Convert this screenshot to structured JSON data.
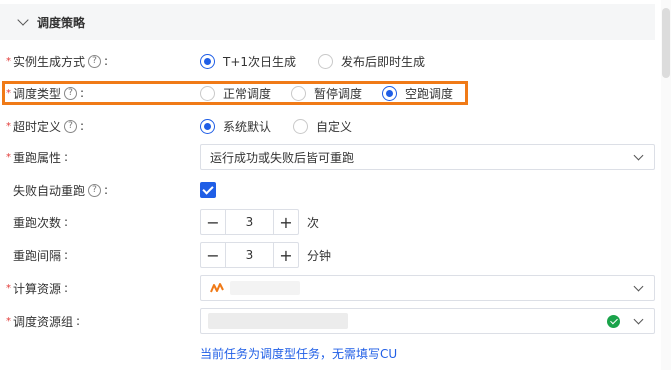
{
  "section": {
    "title": "调度策略"
  },
  "fields": {
    "instance_gen": {
      "label": "实例生成方式",
      "required": "*",
      "help": "?",
      "colon": ":",
      "options": [
        "T+1次日生成",
        "发布后即时生成"
      ],
      "selected_index": 0
    },
    "schedule_type": {
      "label": "调度类型",
      "required": "*",
      "help": "?",
      "colon": ":",
      "options": [
        "正常调度",
        "暂停调度",
        "空跑调度"
      ],
      "selected_index": 2
    },
    "timeout": {
      "label": "超时定义",
      "required": "*",
      "help": "?",
      "colon": ":",
      "options": [
        "系统默认",
        "自定义"
      ],
      "selected_index": 0
    },
    "rerun": {
      "label": "重跑属性",
      "required": "*",
      "colon": ":",
      "value": "运行成功或失败后皆可重跑"
    },
    "auto_rerun": {
      "label": "失败自动重跑",
      "help": "?",
      "colon": ":",
      "checked": true
    },
    "rerun_count": {
      "label": "重跑次数",
      "colon": ":",
      "minus": "−",
      "plus": "+",
      "value": "3",
      "unit": "次"
    },
    "rerun_interval": {
      "label": "重跑间隔",
      "colon": ":",
      "minus": "−",
      "plus": "+",
      "value": "3",
      "unit": "分钟"
    },
    "compute": {
      "label": "计算资源",
      "required": "*",
      "colon": ":",
      "icon": "compute-engine-icon"
    },
    "resource_group": {
      "label": "调度资源组",
      "required": "*",
      "colon": ":"
    }
  },
  "note": "当前任务为调度型任务，无需填写CU",
  "colors": {
    "accent": "#1f5ee6",
    "highlight": "#f07a17",
    "required": "#e23c39",
    "success": "#1aa34a"
  }
}
